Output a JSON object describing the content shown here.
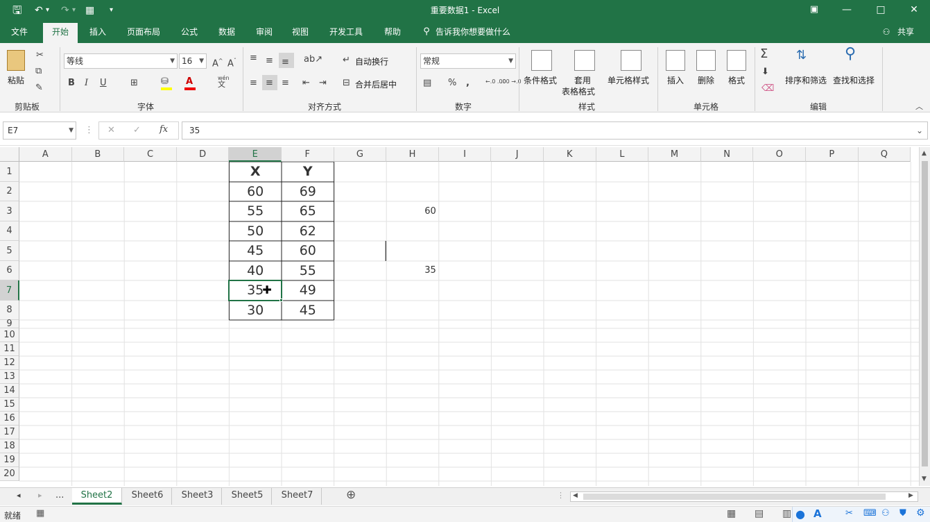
{
  "window": {
    "title": "重要数据1  -  Excel",
    "restore_icon": "□",
    "minimize_icon": "—",
    "close_icon": "✕",
    "ribbon_display_icon": "▣"
  },
  "quick_access": {
    "save_icon": "save-icon",
    "undo": "↶",
    "redo": "↷",
    "calc": "▦",
    "customize": "▾"
  },
  "tabs": [
    "文件",
    "开始",
    "插入",
    "页面布局",
    "公式",
    "数据",
    "审阅",
    "视图",
    "开发工具",
    "帮助"
  ],
  "active_tab": "开始",
  "tell_me": "告诉我你想要做什么",
  "share": "共享",
  "ribbon": {
    "clipboard": {
      "paste": "粘贴",
      "label": "剪贴板"
    },
    "font": {
      "name": "等线",
      "size": "16",
      "bold": "B",
      "italic": "I",
      "underline": "U",
      "label": "字体",
      "wen": "wén",
      "wen_char": "文"
    },
    "align": {
      "wrap": "自动换行",
      "merge": "合并后居中",
      "label": "对齐方式"
    },
    "number": {
      "format": "常规",
      "percent": "%",
      "comma": ",",
      "inc_dec": "←.0 .00",
      "dec_dec": ".00 →.0",
      "label": "数字"
    },
    "styles": {
      "cond": "条件格式",
      "table1": "套用",
      "table2": "表格格式",
      "cell": "单元格样式",
      "label": "样式"
    },
    "cells": {
      "insert": "插入",
      "delete": "删除",
      "format": "格式",
      "label": "单元格"
    },
    "edit": {
      "sort": "排序和筛选",
      "find": "查找和选择",
      "label": "编辑",
      "sigma": "Σ"
    }
  },
  "formula_bar": {
    "name_box": "E7",
    "value": "35",
    "cancel": "✕",
    "enter": "✓",
    "fx": "fx"
  },
  "columns": [
    "A",
    "B",
    "C",
    "D",
    "E",
    "F",
    "G",
    "H",
    "I",
    "J",
    "K",
    "L",
    "M",
    "N",
    "O",
    "P",
    "Q"
  ],
  "rows": [
    "1",
    "2",
    "3",
    "4",
    "5",
    "6",
    "7",
    "8",
    "9",
    "10",
    "11",
    "12",
    "13",
    "14",
    "15",
    "16",
    "17",
    "18",
    "19",
    "20"
  ],
  "table": {
    "headers": [
      "X",
      "Y"
    ],
    "x": [
      "60",
      "55",
      "50",
      "45",
      "40",
      "35",
      "30"
    ],
    "y": [
      "69",
      "65",
      "62",
      "60",
      "55",
      "49",
      "45"
    ]
  },
  "side_values": {
    "h3": "60",
    "h6": "35"
  },
  "sheets": [
    "Sheet2",
    "Sheet6",
    "Sheet3",
    "Sheet5",
    "Sheet7"
  ],
  "active_sheet": "Sheet2",
  "sheet_nav": {
    "prev": "◂",
    "next": "▸",
    "more": "...",
    "add": "⊕"
  },
  "status": {
    "ready": "就绪"
  }
}
